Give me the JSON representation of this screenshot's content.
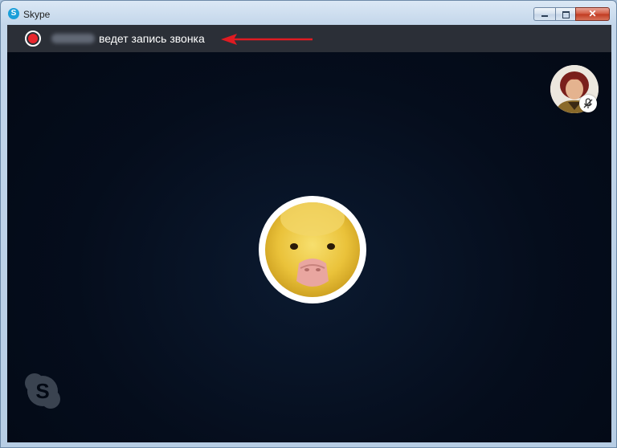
{
  "window": {
    "title": "Skype",
    "app_icon": "skype-icon",
    "controls": {
      "minimize": "minimize-icon",
      "maximize": "maximize-icon",
      "close": "close-icon",
      "close_glyph": "✕"
    }
  },
  "recording_bar": {
    "status_icon": "record-icon",
    "caller_name_blurred": true,
    "message": "ведет запись звонка",
    "annotation": "red-arrow"
  },
  "self_view": {
    "avatar": "self-avatar",
    "mic_status_icon": "mic-muted-icon"
  },
  "caller": {
    "avatar": "duckling-avatar"
  },
  "watermark": {
    "icon": "skype-logo-icon"
  },
  "colors": {
    "record_red": "#e8262d",
    "arrow_red": "#e01b22",
    "bar_bg": "#2b2f37",
    "call_bg": "#050d1c"
  }
}
